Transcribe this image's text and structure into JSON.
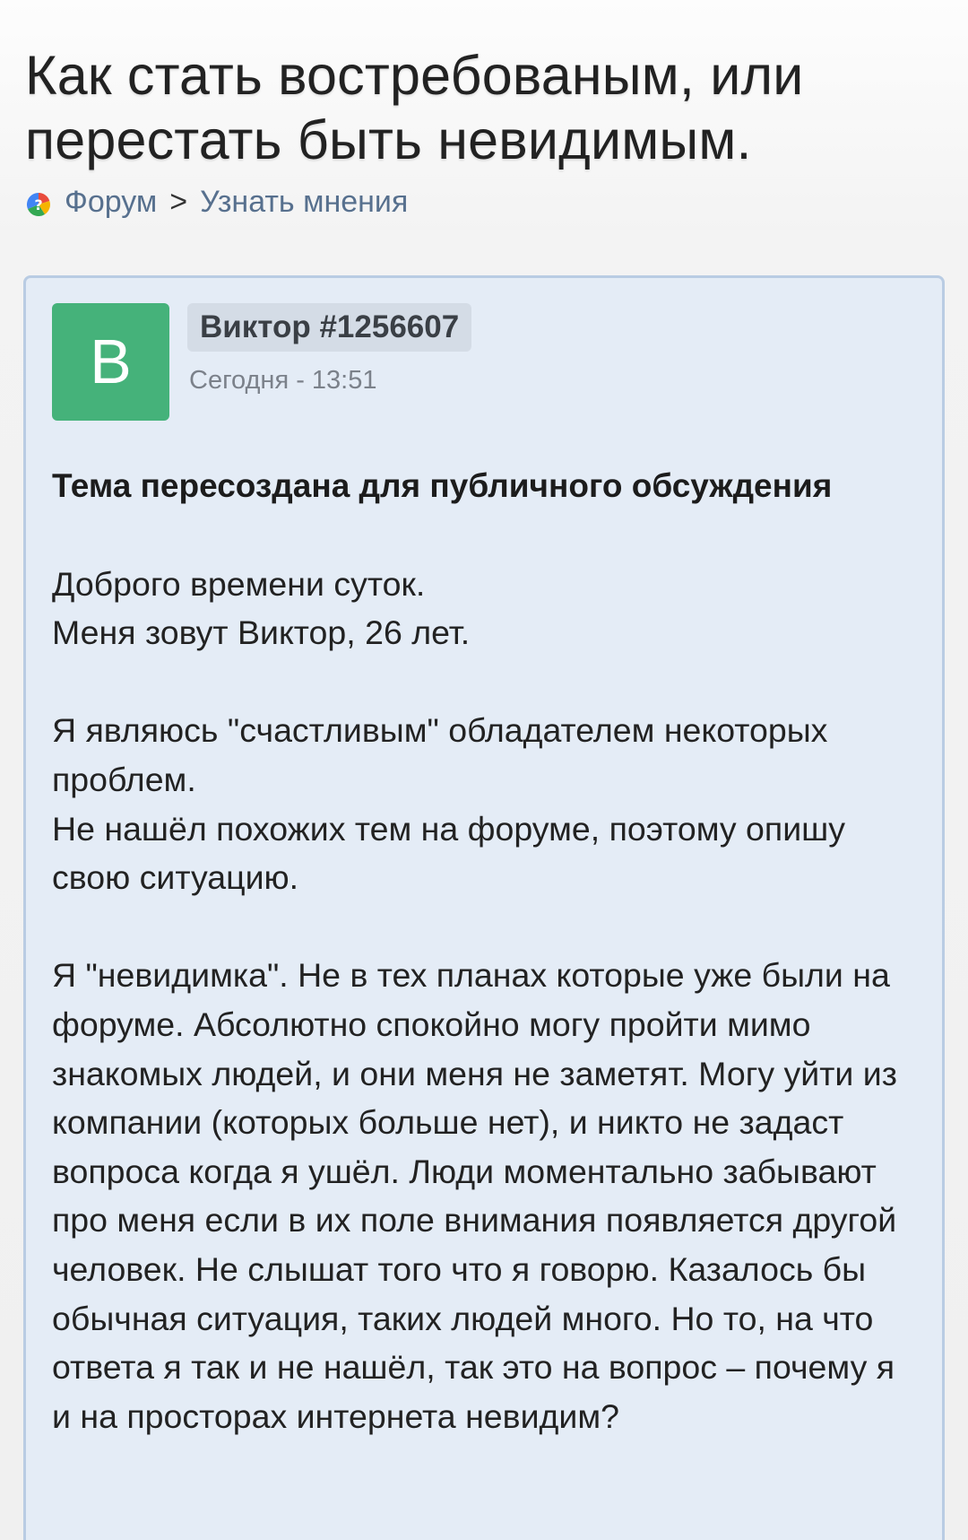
{
  "header": {
    "title": "Как стать востребованым, или перестать быть невидимым.",
    "breadcrumb": {
      "icon": "forum-logo-icon",
      "forum_label": "Форум",
      "separator": ">",
      "section_label": "Узнать мнения"
    }
  },
  "post": {
    "avatar_letter": "В",
    "avatar_color": "#45b27a",
    "author": "Виктор #1256607",
    "timestamp": "Сегодня - 13:51",
    "heading": "Тема пересоздана для публичного обсуждения",
    "lines": {
      "l1": "Доброго времени суток.",
      "l2": "Меня зовут Виктор, 26 лет.",
      "l3": "Я являюсь \"счастливым\" обладателем некоторых проблем.",
      "l4": "Не нашёл похожих тем на форуме, поэтому опишу свою ситуацию.",
      "l5": "Я \"невидимка\". Не в тех планах которые уже были на форуме. Абсолютно спокойно могу пройти мимо знакомых людей, и они меня не заметят. Могу уйти из компании (которых больше нет), и никто не задаст вопроса когда я ушёл. Люди моментально забывают про меня если в их поле внимания появляется другой человек. Не слышат того что я говорю. Казалось бы обычная ситуация, таких людей много. Но то, на что ответа я так и не нашёл, так это на вопрос – почему я и на просторах интернета невидим?"
    }
  }
}
